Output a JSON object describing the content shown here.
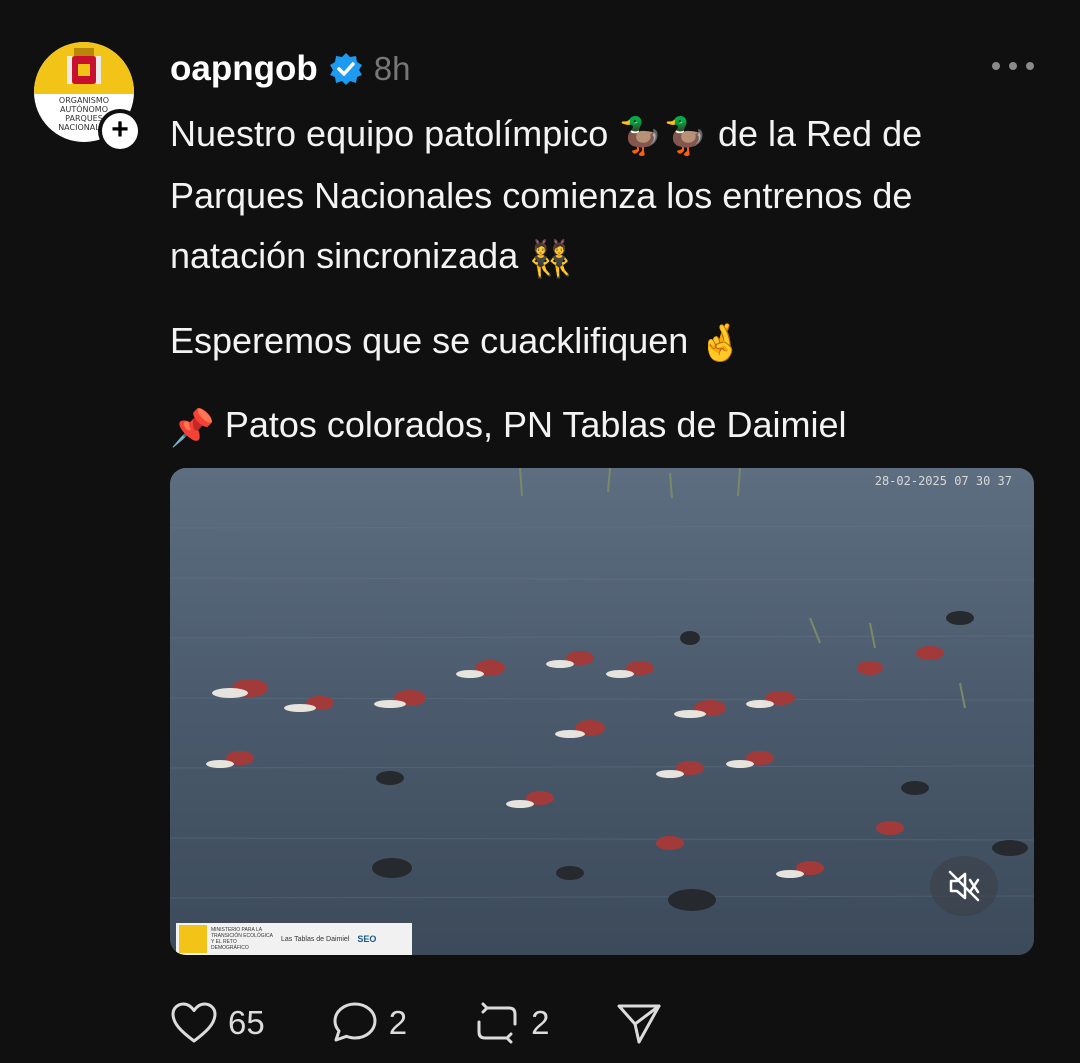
{
  "author": {
    "username": "oapngob",
    "timestamp": "8h",
    "avatar_text": "ORGANISMO AUTÓNOMO PARQUES NACIONALES",
    "verified_icon": "verified-badge-icon",
    "verified_color": "#1d9bf0"
  },
  "post": {
    "line1_a": "Nuestro equipo patolímpico",
    "line1_emoji": "🦆🦆",
    "line1_b": "de la Red de Parques Nacionales comienza los entrenos de natación sincronizada",
    "line1_emoji2": "👯",
    "line2": "Esperemos que se cuacklifiquen",
    "line2_emoji": "🤞",
    "line3_emoji": "📌",
    "line3": "Patos colorados, PN Tablas de Daimiel"
  },
  "media": {
    "timestamp": "28-02-2025 07 30 37",
    "strip": {
      "ministry": "MINISTERIO PARA LA TRANSICIÓN ECOLÓGICA Y EL RETO DEMOGRÁFICO",
      "tablas": "Las Tablas de Daimiel",
      "seo": "SEO"
    },
    "mute_icon": "muted-speaker-icon"
  },
  "actions": {
    "likes": "65",
    "comments": "2",
    "reposts": "2",
    "like_icon": "heart-icon",
    "comment_icon": "comment-bubble-icon",
    "repost_icon": "repost-icon",
    "share_icon": "send-icon"
  }
}
